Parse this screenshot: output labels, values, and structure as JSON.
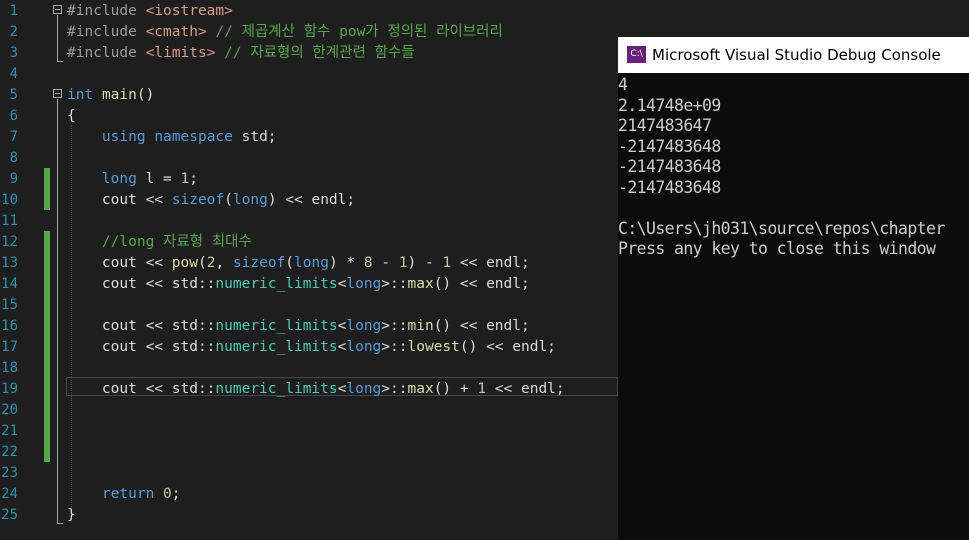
{
  "editor": {
    "lines": [
      {
        "n": "1",
        "tokens": [
          [
            "pp",
            "#include "
          ],
          [
            "inc",
            "<iostream>"
          ]
        ]
      },
      {
        "n": "2",
        "tokens": [
          [
            "pp",
            "#include "
          ],
          [
            "inc",
            "<cmath>"
          ],
          [
            "cm",
            " // 제곱계산 함수 pow가 정의된 라이브러리"
          ]
        ]
      },
      {
        "n": "3",
        "tokens": [
          [
            "pp",
            "#include "
          ],
          [
            "inc",
            "<limits>"
          ],
          [
            "cm",
            " // 자료형의 한계관련 함수들"
          ]
        ]
      },
      {
        "n": "4",
        "tokens": []
      },
      {
        "n": "5",
        "tokens": [
          [
            "kw",
            "int"
          ],
          [
            "t",
            " "
          ],
          [
            "fn",
            "main"
          ],
          [
            "t",
            "()"
          ]
        ]
      },
      {
        "n": "6",
        "tokens": [
          [
            "t",
            "{"
          ]
        ]
      },
      {
        "n": "7",
        "tokens": [
          [
            "t",
            "    "
          ],
          [
            "kw",
            "using"
          ],
          [
            "t",
            " "
          ],
          [
            "kw",
            "namespace"
          ],
          [
            "t",
            " std;"
          ]
        ]
      },
      {
        "n": "8",
        "tokens": []
      },
      {
        "n": "9",
        "tokens": [
          [
            "t",
            "    "
          ],
          [
            "kw",
            "long"
          ],
          [
            "t",
            " l = "
          ],
          [
            "num",
            "1"
          ],
          [
            "t",
            ";"
          ]
        ]
      },
      {
        "n": "10",
        "tokens": [
          [
            "t",
            "    cout << "
          ],
          [
            "kw",
            "sizeof"
          ],
          [
            "t",
            "("
          ],
          [
            "kw",
            "long"
          ],
          [
            "t",
            ") << endl;"
          ]
        ]
      },
      {
        "n": "11",
        "tokens": []
      },
      {
        "n": "12",
        "tokens": [
          [
            "t",
            "    "
          ],
          [
            "cm",
            "//long 자료형 최대수"
          ]
        ]
      },
      {
        "n": "13",
        "tokens": [
          [
            "t",
            "    cout << "
          ],
          [
            "fn",
            "pow"
          ],
          [
            "t",
            "("
          ],
          [
            "num",
            "2"
          ],
          [
            "t",
            ", "
          ],
          [
            "kw",
            "sizeof"
          ],
          [
            "t",
            "("
          ],
          [
            "kw",
            "long"
          ],
          [
            "t",
            ") * "
          ],
          [
            "num",
            "8"
          ],
          [
            "t",
            " - "
          ],
          [
            "num",
            "1"
          ],
          [
            "t",
            ") - "
          ],
          [
            "num",
            "1"
          ],
          [
            "t",
            " << endl;"
          ]
        ]
      },
      {
        "n": "14",
        "tokens": [
          [
            "t",
            "    cout << std::"
          ],
          [
            "ty",
            "numeric_limits"
          ],
          [
            "t",
            "<"
          ],
          [
            "kw",
            "long"
          ],
          [
            "t",
            ">::"
          ],
          [
            "fn",
            "max"
          ],
          [
            "t",
            "() << endl;"
          ]
        ]
      },
      {
        "n": "15",
        "tokens": []
      },
      {
        "n": "16",
        "tokens": [
          [
            "t",
            "    cout << std::"
          ],
          [
            "ty",
            "numeric_limits"
          ],
          [
            "t",
            "<"
          ],
          [
            "kw",
            "long"
          ],
          [
            "t",
            ">::"
          ],
          [
            "fn",
            "min"
          ],
          [
            "t",
            "() << endl;"
          ]
        ]
      },
      {
        "n": "17",
        "tokens": [
          [
            "t",
            "    cout << std::"
          ],
          [
            "ty",
            "numeric_limits"
          ],
          [
            "t",
            "<"
          ],
          [
            "kw",
            "long"
          ],
          [
            "t",
            ">::"
          ],
          [
            "fn",
            "lowest"
          ],
          [
            "t",
            "() << endl;"
          ]
        ]
      },
      {
        "n": "18",
        "tokens": []
      },
      {
        "n": "19",
        "tokens": [
          [
            "t",
            "    cout << std::"
          ],
          [
            "ty",
            "numeric_limits"
          ],
          [
            "t",
            "<"
          ],
          [
            "kw",
            "long"
          ],
          [
            "t",
            ">::"
          ],
          [
            "fn",
            "max"
          ],
          [
            "t",
            "() + "
          ],
          [
            "num",
            "1"
          ],
          [
            "t",
            " << endl;"
          ]
        ]
      },
      {
        "n": "20",
        "tokens": []
      },
      {
        "n": "21",
        "tokens": []
      },
      {
        "n": "22",
        "tokens": []
      },
      {
        "n": "23",
        "tokens": []
      },
      {
        "n": "24",
        "tokens": [
          [
            "t",
            "    "
          ],
          [
            "kw",
            "return"
          ],
          [
            "t",
            " "
          ],
          [
            "num",
            "0"
          ],
          [
            "t",
            ";"
          ]
        ]
      },
      {
        "n": "25",
        "tokens": [
          [
            "t",
            "}"
          ]
        ]
      }
    ],
    "colors": {
      "line_number": "#2b91af",
      "keyword": "#569cd6",
      "preprocessor": "#9b9b9b",
      "include_path": "#d69d85",
      "comment": "#57a64a",
      "type": "#4ec9b0",
      "number": "#b5cea8",
      "function": "#dcdcaa",
      "text": "#dcdcdc",
      "background": "#1e1e1e"
    }
  },
  "console": {
    "title": "Microsoft Visual Studio Debug Console",
    "icon": "debug-console-icon",
    "icon_text": "C:\\",
    "output": [
      "4",
      "2.14748e+09",
      "2147483647",
      "-2147483648",
      "-2147483648",
      "-2147483648",
      "",
      "C:\\Users\\jh031\\source\\repos\\chapter",
      "Press any key to close this window"
    ],
    "colors": {
      "background": "#0c0c0c",
      "text": "#cccccc",
      "titlebar": "#ffffff"
    }
  }
}
